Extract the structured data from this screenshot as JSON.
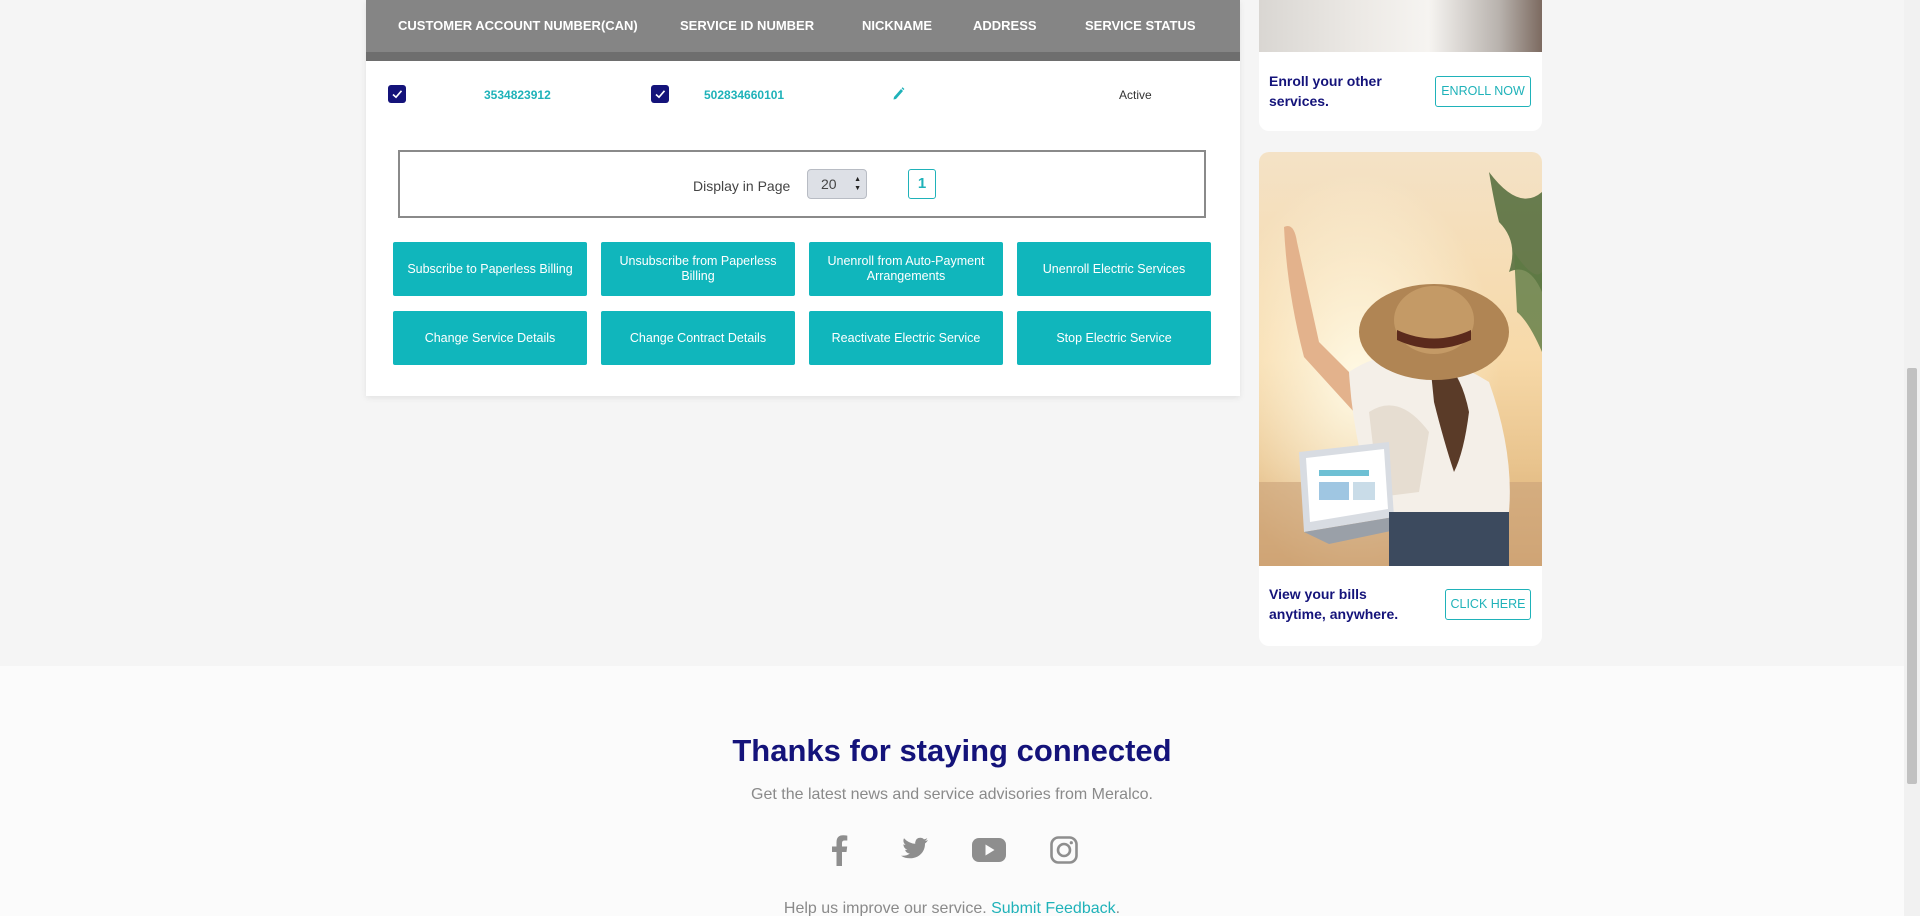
{
  "table": {
    "headers": {
      "can": "CUSTOMER ACCOUNT NUMBER(CAN)",
      "service_id": "SERVICE ID NUMBER",
      "nickname": "NICKNAME",
      "address": "ADDRESS",
      "status": "SERVICE STATUS"
    },
    "rows": [
      {
        "can": "3534823912",
        "service_id": "502834660101",
        "nickname": "",
        "address": "",
        "status": "Active",
        "can_checked": true,
        "service_checked": true
      }
    ]
  },
  "pager": {
    "label": "Display in Page",
    "page_size": "20",
    "current_page": "1"
  },
  "actions": {
    "subscribe_paperless": "Subscribe to Paperless Billing",
    "unsubscribe_paperless": "Unsubscribe from Paperless Billing",
    "unenroll_autopay": "Unenroll from Auto-Payment Arrangements",
    "unenroll_electric": "Unenroll Electric Services",
    "change_service": "Change Service Details",
    "change_contract": "Change Contract Details",
    "reactivate": "Reactivate Electric Service",
    "stop": "Stop Electric Service"
  },
  "ads": {
    "enroll": {
      "text": "Enroll your other services.",
      "button": "ENROLL NOW"
    },
    "bills": {
      "text": "View your bills anytime, anywhere.",
      "button": "CLICK HERE"
    }
  },
  "footer": {
    "title": "Thanks for staying connected",
    "subtitle": "Get the latest news and service advisories from Meralco.",
    "help_text": "Help us improve our service. ",
    "feedback_link": "Submit Feedback",
    "feedback_suffix": ".",
    "social": [
      "facebook-icon",
      "twitter-icon",
      "youtube-icon",
      "instagram-icon"
    ]
  },
  "colors": {
    "navy": "#14137a",
    "teal": "#10b6bc",
    "table_header": "#858585"
  }
}
